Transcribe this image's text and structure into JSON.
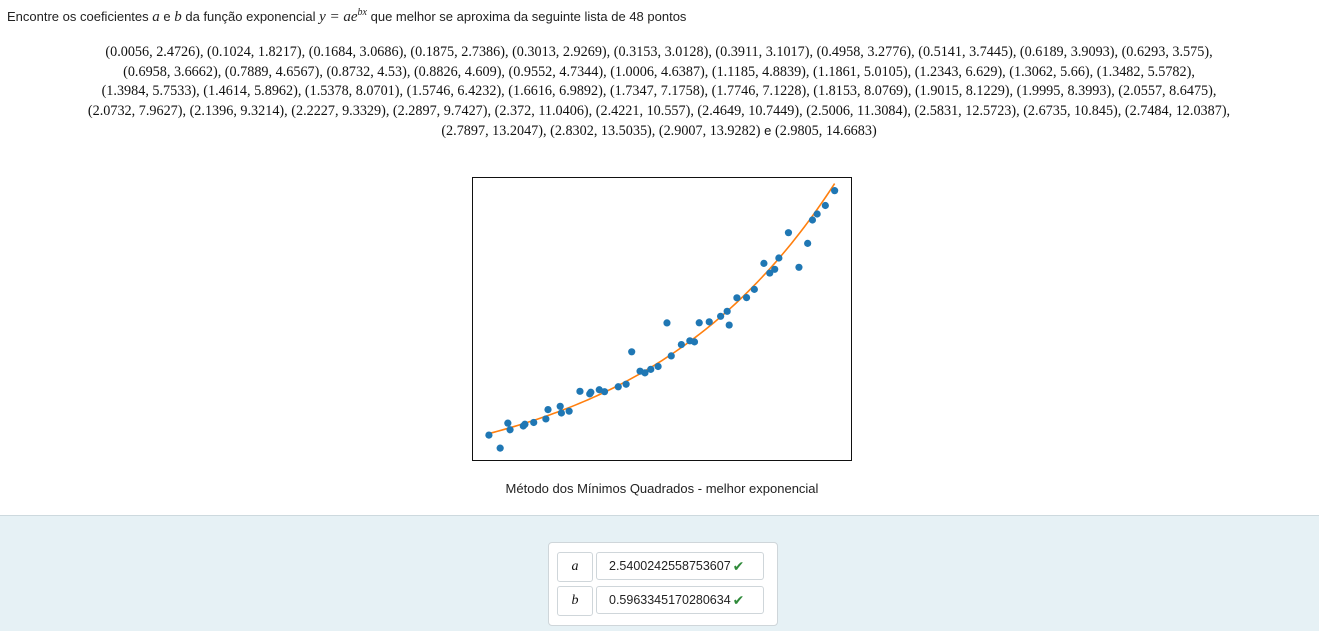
{
  "question": {
    "prefix": "Encontre os coeficientes",
    "var_a": "a",
    "conj": "e",
    "var_b": "b",
    "mid": "da função exponencial",
    "formula_lhs": "y = ae",
    "formula_exp": "bx",
    "suffix": "que melhor se aproxima da seguinte lista de 48 pontos"
  },
  "points_text": [
    "(0.0056, 2.4726)",
    "(0.1024, 1.8217)",
    "(0.1684, 3.0686)",
    "(0.1875, 2.7386)",
    "(0.3013, 2.9269)",
    "(0.3153, 3.0128)",
    "(0.3911, 3.1017)",
    "(0.4958, 3.2776)",
    "(0.5141, 3.7445)",
    "(0.6189, 3.9093)",
    "(0.6293, 3.575)",
    "(0.6958, 3.6662)",
    "(0.7889, 4.6567)",
    "(0.8732, 4.53)",
    "(0.8826, 4.609)",
    "(0.9552, 4.7344)",
    "(1.0006, 4.6387)",
    "(1.1185, 4.8839)",
    "(1.1861, 5.0105)",
    "(1.2343, 6.629)",
    "(1.3062, 5.66)",
    "(1.3482, 5.5782)",
    "(1.3984, 5.7533)",
    "(1.4614, 5.8962)",
    "(1.5378, 8.0701)",
    "(1.5746, 6.4232)",
    "(1.6616, 6.9892)",
    "(1.7347, 7.1758)",
    "(1.7746, 7.1228)",
    "(1.8153, 8.0769)",
    "(1.9015, 8.1229)",
    "(1.9995, 8.3993)",
    "(2.0557, 8.6475)",
    "(2.0732, 7.9627)",
    "(2.1396, 9.3214)",
    "(2.2227, 9.3329)",
    "(2.2897, 9.7427)",
    "(2.372, 11.0406)",
    "(2.4221, 10.557)",
    "(2.4649, 10.7449)",
    "(2.5006, 11.3084)",
    "(2.5831, 12.5723)",
    "(2.6735, 10.845)",
    "(2.7484, 12.0387)",
    "(2.7897, 13.2047)",
    "(2.8302, 13.5035)",
    "(2.9007, 13.9282)",
    "(2.9805, 14.6683)"
  ],
  "points_lines": [
    11,
    11,
    11,
    11,
    4
  ],
  "points_last_sep": "e",
  "chart_data": {
    "type": "scatter",
    "points": [
      [
        0.0056,
        2.4726
      ],
      [
        0.1024,
        1.8217
      ],
      [
        0.1684,
        3.0686
      ],
      [
        0.1875,
        2.7386
      ],
      [
        0.3013,
        2.9269
      ],
      [
        0.3153,
        3.0128
      ],
      [
        0.3911,
        3.1017
      ],
      [
        0.4958,
        3.2776
      ],
      [
        0.5141,
        3.7445
      ],
      [
        0.6189,
        3.9093
      ],
      [
        0.6293,
        3.575
      ],
      [
        0.6958,
        3.6662
      ],
      [
        0.7889,
        4.6567
      ],
      [
        0.8732,
        4.53
      ],
      [
        0.8826,
        4.609
      ],
      [
        0.9552,
        4.7344
      ],
      [
        1.0006,
        4.6387
      ],
      [
        1.1185,
        4.8839
      ],
      [
        1.1861,
        5.0105
      ],
      [
        1.2343,
        6.629
      ],
      [
        1.3062,
        5.66
      ],
      [
        1.3482,
        5.5782
      ],
      [
        1.3984,
        5.7533
      ],
      [
        1.4614,
        5.8962
      ],
      [
        1.5378,
        8.0701
      ],
      [
        1.5746,
        6.4232
      ],
      [
        1.6616,
        6.9892
      ],
      [
        1.7347,
        7.1758
      ],
      [
        1.7746,
        7.1228
      ],
      [
        1.8153,
        8.0769
      ],
      [
        1.9015,
        8.1229
      ],
      [
        1.9995,
        8.3993
      ],
      [
        2.0557,
        8.6475
      ],
      [
        2.0732,
        7.9627
      ],
      [
        2.1396,
        9.3214
      ],
      [
        2.2227,
        9.3329
      ],
      [
        2.2897,
        9.7427
      ],
      [
        2.372,
        11.0406
      ],
      [
        2.4221,
        10.557
      ],
      [
        2.4649,
        10.7449
      ],
      [
        2.5006,
        11.3084
      ],
      [
        2.5831,
        12.5723
      ],
      [
        2.6735,
        10.845
      ],
      [
        2.7484,
        12.0387
      ],
      [
        2.7897,
        13.2047
      ],
      [
        2.8302,
        13.5035
      ],
      [
        2.9007,
        13.9282
      ],
      [
        2.9805,
        14.6683
      ]
    ],
    "fit": {
      "a": 2.5400242558753607,
      "b": 0.5963345170280634
    },
    "xlim": [
      -0.14,
      3.13
    ],
    "ylim": [
      1.18,
      15.35
    ],
    "grid": false,
    "axes_ticks": false,
    "point_color": "#1f77b4",
    "fit_color": "#ff7f0e",
    "caption": "Método dos Mínimos Quadrados - melhor exponencial"
  },
  "answers": [
    {
      "label": "a",
      "value": "2.5400242558753607"
    },
    {
      "label": "b",
      "value": "0.5963345170280634"
    }
  ],
  "check_glyph": "✔",
  "colors": {
    "panel_bg": "#e6f1f5",
    "check": "#2f8a3a"
  }
}
